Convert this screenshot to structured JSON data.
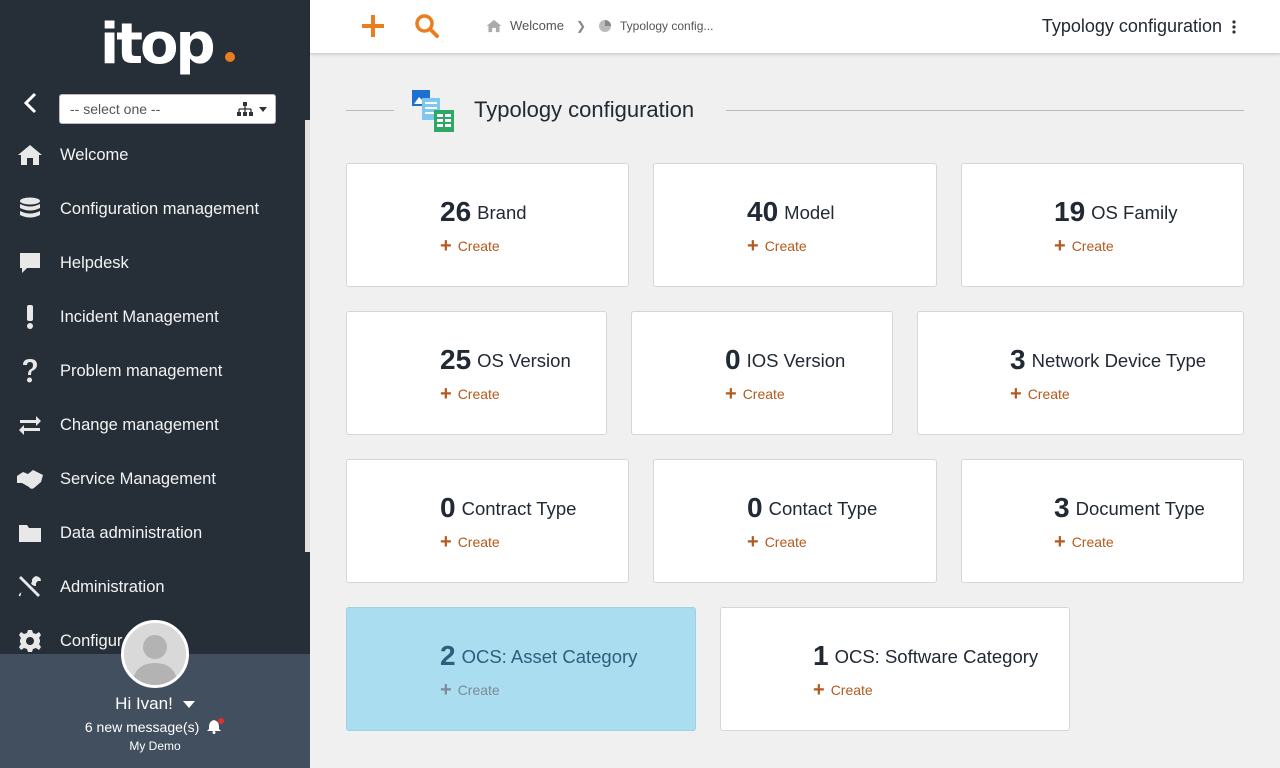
{
  "sidebar": {
    "logo_text": "itop",
    "org_select_value": "-- select one --",
    "menu": [
      {
        "label": "Welcome",
        "icon": "home-icon"
      },
      {
        "label": "Configuration management",
        "icon": "database-icon"
      },
      {
        "label": "Helpdesk",
        "icon": "comment-icon"
      },
      {
        "label": "Incident Management",
        "icon": "exclamation-icon"
      },
      {
        "label": "Problem management",
        "icon": "question-icon"
      },
      {
        "label": "Change management",
        "icon": "exchange-icon"
      },
      {
        "label": "Service Management",
        "icon": "handshake-icon"
      },
      {
        "label": "Data administration",
        "icon": "folder-icon"
      },
      {
        "label": "Administration",
        "icon": "tools-icon"
      },
      {
        "label": "Configur",
        "icon": "gear-icon"
      }
    ],
    "user": {
      "greeting": "Hi Ivan!",
      "messages": "6 new message(s)",
      "organization": "My Demo"
    }
  },
  "topbar": {
    "breadcrumb": [
      "Welcome",
      "Typology config..."
    ],
    "page_title": "Typology configuration"
  },
  "main": {
    "section_title": "Typology configuration",
    "create_label": "Create",
    "cards": [
      {
        "count": "26",
        "label": "Brand"
      },
      {
        "count": "40",
        "label": "Model"
      },
      {
        "count": "19",
        "label": "OS Family"
      },
      {
        "count": "25",
        "label": "OS Version"
      },
      {
        "count": "0",
        "label": "IOS Version"
      },
      {
        "count": "3",
        "label": "Network Device Type"
      },
      {
        "count": "0",
        "label": "Contract Type"
      },
      {
        "count": "0",
        "label": "Contact Type"
      },
      {
        "count": "3",
        "label": "Document Type"
      },
      {
        "count": "2",
        "label": "OCS: Asset Category"
      },
      {
        "count": "1",
        "label": "OCS: Software Category"
      }
    ]
  },
  "colors": {
    "accent": "#ea7d1e",
    "sidebar_bg": "#262f38",
    "highlight_card": "#abddf1",
    "create_link": "#b45a1e"
  }
}
